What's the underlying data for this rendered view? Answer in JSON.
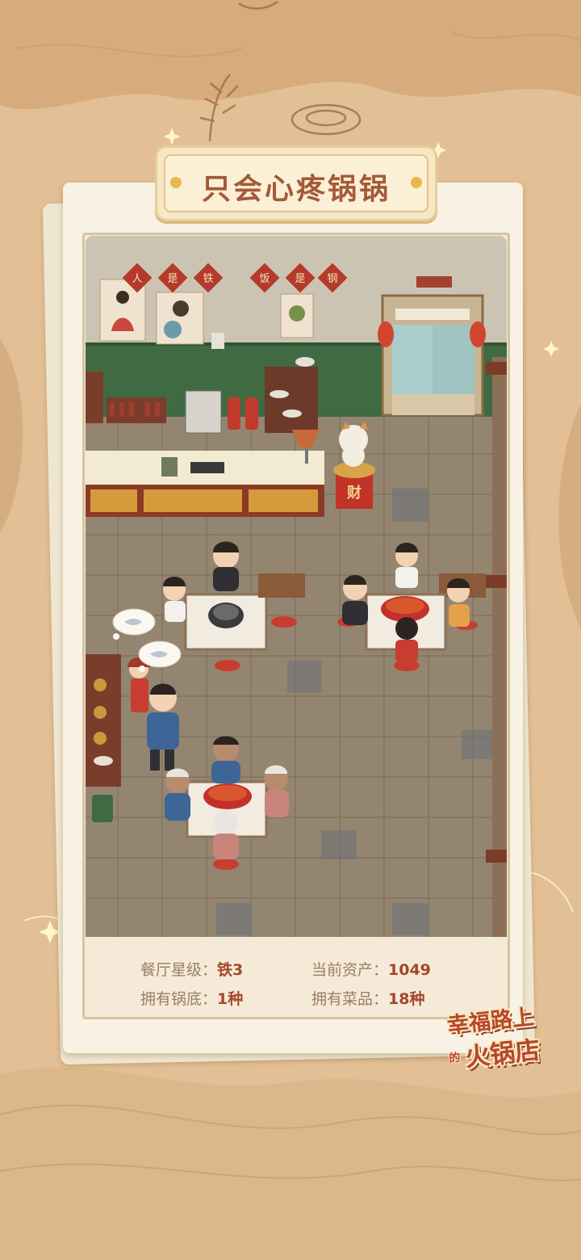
{
  "restaurant": {
    "name": "只会心疼锅锅"
  },
  "scene": {
    "wall_banner_chars": [
      "人",
      "是",
      "铁",
      "饭",
      "是",
      "钢"
    ],
    "fortune_sign": "财"
  },
  "stats": {
    "star_level": {
      "label": "餐厅星级：",
      "value": "铁3"
    },
    "assets": {
      "label": "当前资产：",
      "value": "1049"
    },
    "soup_bases": {
      "label": "拥有锅底：",
      "value": "1种"
    },
    "dishes": {
      "label": "拥有菜品：",
      "value": "18种"
    }
  },
  "logo": {
    "line1": "幸福路上",
    "line2_small": "的",
    "line2": "火锅店"
  },
  "colors": {
    "background": "#e2bf94",
    "card": "#f8f2e4",
    "title_text": "#a25a3a",
    "stat_value": "#a4472c",
    "wall_green": "#3f6a42",
    "floor": "#948570"
  }
}
